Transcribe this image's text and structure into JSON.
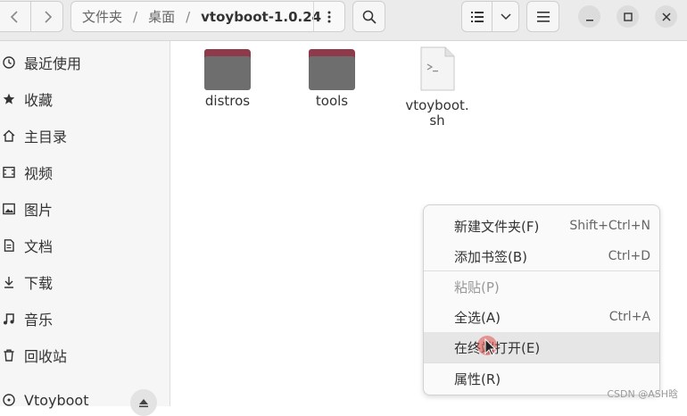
{
  "toolbar": {
    "back_icon": "chevron-left-icon",
    "forward_icon": "chevron-right-icon",
    "breadcrumb": [
      "文件夹",
      "桌面",
      "vtoyboot-1.0.24"
    ],
    "path_menu_icon": "vertical-dots-icon",
    "search_icon": "search-icon",
    "view_list_icon": "list-view-icon",
    "view_dropdown_icon": "chevron-down-icon",
    "main_menu_icon": "hamburger-menu-icon",
    "minimize_icon": "minimize-icon",
    "maximize_icon": "maximize-icon",
    "close_icon": "close-icon"
  },
  "sidebar": {
    "items": [
      {
        "label": "最近使用",
        "icon": "clock-icon"
      },
      {
        "label": "收藏",
        "icon": "star-icon"
      },
      {
        "label": "主目录",
        "icon": "home-icon"
      },
      {
        "label": "视频",
        "icon": "video-icon"
      },
      {
        "label": "图片",
        "icon": "image-icon"
      },
      {
        "label": "文档",
        "icon": "document-icon"
      },
      {
        "label": "下载",
        "icon": "download-icon"
      },
      {
        "label": "音乐",
        "icon": "music-icon"
      },
      {
        "label": "回收站",
        "icon": "trash-icon"
      },
      {
        "label": "Vtoyboot",
        "icon": "drive-icon"
      }
    ],
    "eject_icon": "eject-icon"
  },
  "files": [
    {
      "name": "distros",
      "type": "folder"
    },
    {
      "name": "tools",
      "type": "folder"
    },
    {
      "name_lines": [
        "vtoyboot.",
        "sh"
      ],
      "type": "script"
    }
  ],
  "context_menu": {
    "items": [
      {
        "label": "新建文件夹(F)",
        "shortcut": "Shift+Ctrl+N"
      },
      {
        "label": "添加书签(B)",
        "shortcut": "Ctrl+D"
      },
      {
        "label": "粘贴(P)",
        "shortcut": ""
      },
      {
        "label": "全选(A)",
        "shortcut": "Ctrl+A"
      },
      {
        "label": "在终端打开(E)",
        "shortcut": ""
      },
      {
        "label": "属性(R)",
        "shortcut": ""
      }
    ]
  },
  "watermark": "CSDN @ASH晗",
  "colors": {
    "folder_tab": "#8f3a4a",
    "folder_body": "#6e6e6e",
    "cursor_highlight": "#e0504a"
  }
}
